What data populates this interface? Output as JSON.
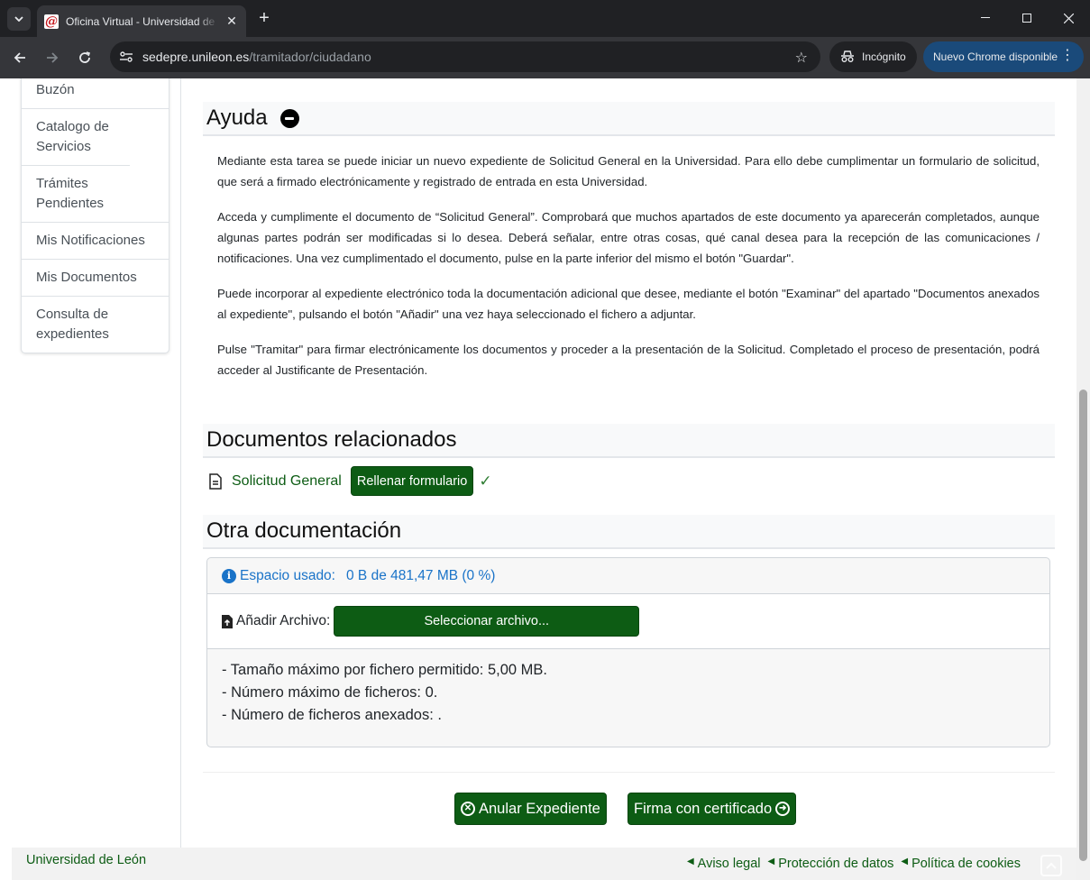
{
  "browser": {
    "tab_title": "Oficina Virtual - Universidad de León",
    "url_host": "sedepre.unileon.es",
    "url_path": "/tramitador/ciudadano",
    "incognito_label": "Incógnito",
    "update_label": "Nuevo Chrome disponible"
  },
  "sidebar": {
    "items": [
      {
        "label": "Buzón"
      },
      {
        "label": "Catalogo de Servicios"
      },
      {
        "label": "Trámites Pendientes"
      },
      {
        "label": "Mis Notificaciones"
      },
      {
        "label": "Mis Documentos"
      },
      {
        "label": "Consulta de expedientes"
      }
    ]
  },
  "help": {
    "title": "Ayuda",
    "paragraphs": [
      "Mediante esta tarea se puede iniciar un nuevo expediente de Solicitud General en la Universidad. Para ello debe cumplimentar un formulario de solicitud, que será a firmado electrónicamente y registrado de entrada en esta Universidad.",
      "Acceda y cumplimente el documento de “Solicitud General”. Comprobará que muchos apartados de este documento ya aparecerán completados, aunque algunas partes podrán ser modificadas si lo desea. Deberá señalar, entre otras cosas, qué canal desea para la recepción de las comunicaciones / notificaciones. Una vez cumplimentado el documento, pulse en la parte inferior del mismo el botón \"Guardar\".",
      "Puede incorporar al expediente electrónico toda la documentación adicional que desee, mediante el botón \"Examinar\" del apartado \"Documentos anexados al expediente\", pulsando el botón \"Añadir\" una vez haya seleccionado el fichero a adjuntar.",
      "Pulse \"Tramitar\" para firmar electrónicamente los documentos y proceder a la presentación de la Solicitud. Completado el proceso de presentación, podrá acceder al Justificante de Presentación."
    ]
  },
  "related_docs": {
    "title": "Documentos relacionados",
    "doc_name": "Solicitud General",
    "fill_button": "Rellenar formulario",
    "check_mark": "✓"
  },
  "other_docs": {
    "title": "Otra documentación",
    "space_label": "Espacio usado:",
    "space_value": "0 B de 481,47 MB (0 %)",
    "add_file_label": "Añadir Archivo:",
    "select_button": "Seleccionar archivo...",
    "limits": [
      "- Tamaño máximo por fichero permitido:  5,00 MB.",
      "- Número máximo de ficheros: 0.",
      "- Número de ficheros anexados: ."
    ]
  },
  "actions": {
    "cancel": "Anular Expediente",
    "sign": "Firma con certificado"
  },
  "footer": {
    "org": "Universidad de León",
    "links": [
      {
        "label": "Aviso legal"
      },
      {
        "label": "Protección de datos"
      },
      {
        "label": "Política de cookies"
      }
    ]
  },
  "colors": {
    "brand_green": "#0d5c14",
    "info_blue": "#1a73c8"
  }
}
